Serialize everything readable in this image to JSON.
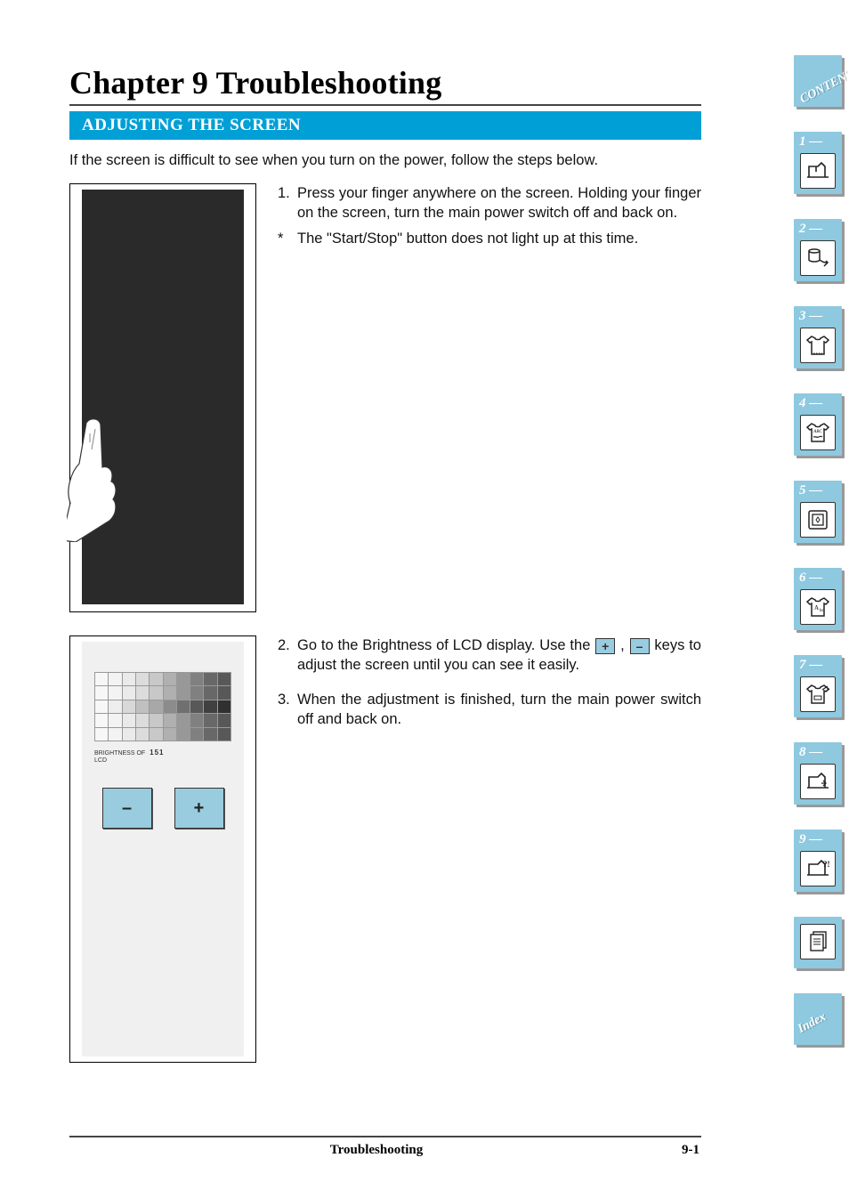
{
  "chapter_title": "Chapter 9 Troubleshooting",
  "section_title": "ADJUSTING THE SCREEN",
  "intro": "If the screen is difficult to see when you turn on the power, follow the steps below.",
  "step1_num": "1.",
  "step1": "Press your finger anywhere on the screen. Holding your finger on the screen, turn the main power switch off and back on.",
  "note_mark": "*",
  "note": "The \"Start/Stop\" button does not light up at this time.",
  "step2_num": "2.",
  "step2_before": "Go to the Brightness of LCD display. Use the ",
  "step2_mid": " , ",
  "step2_after": " keys to adjust the screen until you can see it easily.",
  "step3_num": "3.",
  "step3": "When the adjustment is finished, turn the main power switch off and back on.",
  "brightness_label_line1": "BRIGHTNESS OF",
  "brightness_label_line2": "LCD",
  "brightness_value": "151",
  "key_plus": "+",
  "key_minus": "–",
  "btn_minus": "–",
  "btn_plus": "+",
  "tabs": {
    "contents": "CONTENTS",
    "t1": "1 —",
    "t2": "2 —",
    "t3": "3 —",
    "t4": "4 —",
    "t5": "5 —",
    "t6": "6 —",
    "t7": "7 —",
    "t8": "8 —",
    "t9": "9 —",
    "index": "Index"
  },
  "footer_center": "Troubleshooting",
  "footer_right": "9-1",
  "grid_rows": [
    [
      "#f7f7f7",
      "#f3f3f3",
      "#eaeaea",
      "#dcdcdc",
      "#c8c8c8",
      "#b0b0b0",
      "#989898",
      "#808080",
      "#686868",
      "#585858"
    ],
    [
      "#f7f7f7",
      "#f3f3f3",
      "#eaeaea",
      "#dcdcdc",
      "#c8c8c8",
      "#b0b0b0",
      "#989898",
      "#808080",
      "#686868",
      "#585858"
    ],
    [
      "#f7f7f7",
      "#ededed",
      "#d8d8d8",
      "#c0c0c0",
      "#a8a8a8",
      "#8c8c8c",
      "#707070",
      "#585858",
      "#404040",
      "#303030"
    ],
    [
      "#f7f7f7",
      "#f3f3f3",
      "#eaeaea",
      "#dcdcdc",
      "#c8c8c8",
      "#b0b0b0",
      "#989898",
      "#808080",
      "#686868",
      "#585858"
    ],
    [
      "#f7f7f7",
      "#f3f3f3",
      "#eaeaea",
      "#dcdcdc",
      "#c8c8c8",
      "#b0b0b0",
      "#989898",
      "#808080",
      "#686868",
      "#585858"
    ]
  ]
}
